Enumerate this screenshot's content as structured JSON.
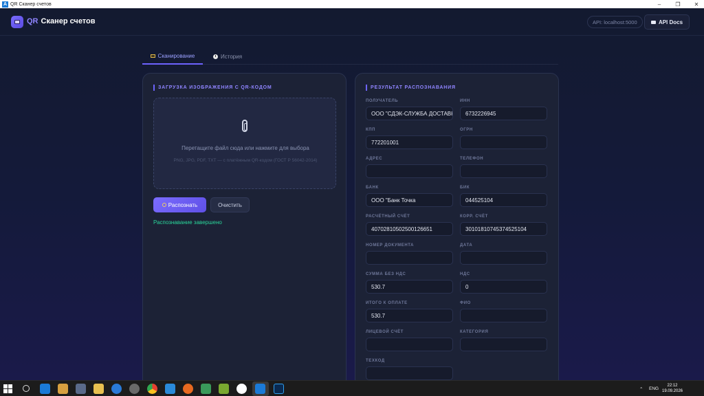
{
  "window": {
    "title": "QR Сканер счетов"
  },
  "header": {
    "brand_prefix": "QR",
    "brand_name": "Сканер счетов",
    "api_badge": "API: localhost:5000",
    "api_docs_label": "API Docs"
  },
  "tabs": [
    {
      "label": "Сканирование",
      "active": true,
      "icon": "scanner-icon"
    },
    {
      "label": "История",
      "active": false,
      "icon": "clock-icon"
    }
  ],
  "upload": {
    "title": "ЗАГРУЗКА ИЗОБРАЖЕНИЯ С QR-КОДОМ",
    "drop_text": "Перетащите файл сюда или нажмите для выбора",
    "drop_hint": "PNG, JPG, PDF, TXT — с платёжным QR-кодом (ГОСТ Р 56042-2014)",
    "recognize_label": "Распознать",
    "clear_label": "Очистить",
    "status": "Распознавание завершено"
  },
  "result": {
    "title": "РЕЗУЛЬТАТ РАСПОЗНАВАНИЯ",
    "fields": [
      {
        "label": "ПОЛУЧАТЕЛЬ",
        "value": "ООО \"СДЭК-СЛУЖБА ДОСТАВКИ\""
      },
      {
        "label": "ИНН",
        "value": "6732226945"
      },
      {
        "label": "КПП",
        "value": "772201001"
      },
      {
        "label": "ОГРН",
        "value": ""
      },
      {
        "label": "АДРЕС",
        "value": ""
      },
      {
        "label": "ТЕЛЕФОН",
        "value": ""
      },
      {
        "label": "БАНК",
        "value": "ООО \"Банк Точка"
      },
      {
        "label": "БИК",
        "value": "044525104"
      },
      {
        "label": "РАСЧЁТНЫЙ СЧЁТ",
        "value": "40702810502500126651"
      },
      {
        "label": "КОРР. СЧЁТ",
        "value": "30101810745374525104"
      },
      {
        "label": "НОМЕР ДОКУМЕНТА",
        "value": ""
      },
      {
        "label": "ДАТА",
        "value": ""
      },
      {
        "label": "СУММА БЕЗ НДС",
        "value": "530.7"
      },
      {
        "label": "НДС",
        "value": "0"
      },
      {
        "label": "ИТОГО К ОПЛАТЕ",
        "value": "530.7"
      },
      {
        "label": "ФИО",
        "value": ""
      },
      {
        "label": "ЛИЦЕВОЙ СЧЁТ",
        "value": ""
      },
      {
        "label": "КАТЕГОРИЯ",
        "value": ""
      },
      {
        "label": "ТЕХКОД",
        "value": ""
      }
    ]
  },
  "taskbar": {
    "lang": "ENG",
    "time": "22:12",
    "date": "19.09.2026",
    "colors": {
      "accent": "#6d63ff",
      "success": "#2ad69a"
    }
  }
}
